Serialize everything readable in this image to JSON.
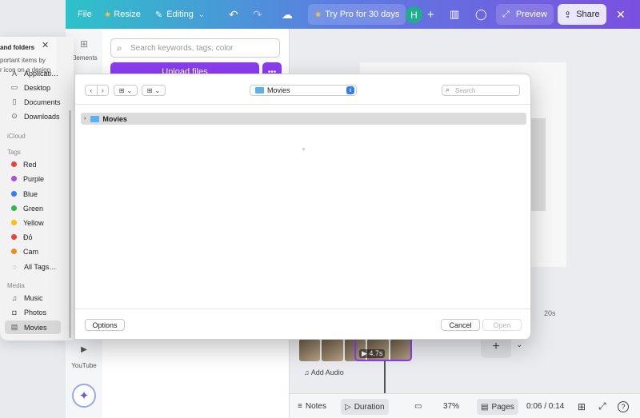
{
  "topbar": {
    "file": "File",
    "resize": "Resize",
    "editing": "Editing",
    "try_pro": "Try Pro for 30 days",
    "avatar_initial": "H",
    "preview": "Preview",
    "share": "Share"
  },
  "rail": {
    "elements": "Elements",
    "youtube": "YouTube"
  },
  "panel": {
    "search_placeholder": "Search keywords, tags, color",
    "upload": "Upload files"
  },
  "tooltip": {
    "title": "and folders",
    "line1": "portant items by",
    "line2": "r icon on a design"
  },
  "finder_sidebar": {
    "favorites": [
      {
        "label": "Applicati…",
        "icon": "applications-icon"
      },
      {
        "label": "Desktop",
        "icon": "desktop-icon"
      },
      {
        "label": "Documents",
        "icon": "document-icon"
      },
      {
        "label": "Downloads",
        "icon": "download-icon"
      }
    ],
    "icloud_header": "iCloud",
    "tags_header": "Tags",
    "tags": [
      {
        "label": "Red",
        "color": "#e8423a"
      },
      {
        "label": "Purple",
        "color": "#a550d8"
      },
      {
        "label": "Blue",
        "color": "#2f7cf6"
      },
      {
        "label": "Green",
        "color": "#2db84a"
      },
      {
        "label": "Yellow",
        "color": "#f5c00f"
      },
      {
        "label": "Đỏ",
        "color": "#e8423a"
      },
      {
        "label": "Cam",
        "color": "#f08a1c"
      }
    ],
    "all_tags": "All Tags…",
    "media_header": "Media",
    "media": [
      {
        "label": "Music",
        "icon": "music-icon"
      },
      {
        "label": "Photos",
        "icon": "camera-icon"
      },
      {
        "label": "Movies",
        "icon": "film-icon"
      }
    ]
  },
  "dialog": {
    "location": "Movies",
    "search_placeholder": "Search",
    "rows": [
      {
        "name": "Movies"
      }
    ],
    "options": "Options",
    "cancel": "Cancel",
    "open": "Open"
  },
  "timeline": {
    "time_marker": "20s",
    "clip_duration": "4.7s",
    "add_audio": "Add Audio"
  },
  "bottombar": {
    "notes": "Notes",
    "duration": "Duration",
    "zoom": "37%",
    "pages": "Pages",
    "time": "0:06 / 0:14",
    "help": "?"
  }
}
